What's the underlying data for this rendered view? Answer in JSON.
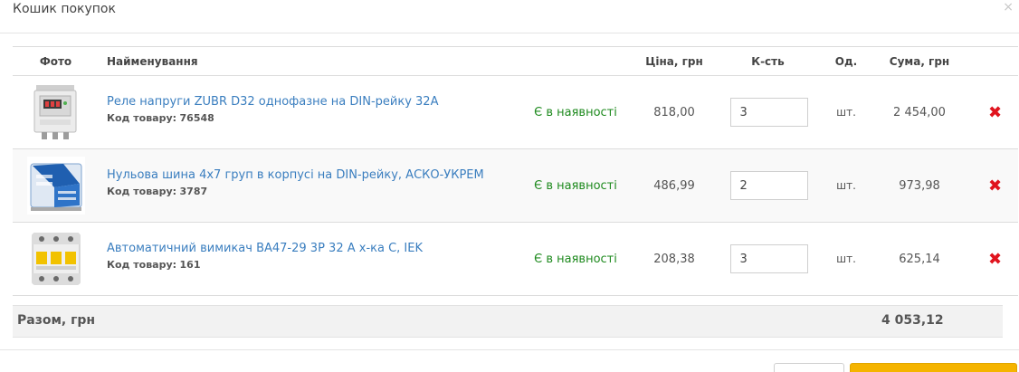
{
  "modal": {
    "title": "Кошик покупок",
    "close_glyph": "×"
  },
  "table": {
    "headers": {
      "photo": "Фото",
      "name": "Найменування",
      "price": "Ціна, грн",
      "qty": "К-сть",
      "unit": "Од.",
      "sum": "Сума, грн"
    },
    "rows": [
      {
        "image_icon": "voltage-relay-image",
        "name": "Реле напруги ZUBR D32 однофазне на DIN-рейку 32А",
        "code_label": "Код товару:",
        "code": "76548",
        "stock": "Є в наявності",
        "price": "818,00",
        "qty": "3",
        "unit": "шт.",
        "sum": "2 454,00",
        "delete_icon": "red-x-icon"
      },
      {
        "image_icon": "neutral-busbar-image",
        "name": "Нульова шина 4х7 груп в корпусі на DIN-рейку, АСКО-УКРЕМ",
        "code_label": "Код товару:",
        "code": "3787",
        "stock": "Є в наявності",
        "price": "486,99",
        "qty": "2",
        "unit": "шт.",
        "sum": "973,98",
        "delete_icon": "red-x-icon"
      },
      {
        "image_icon": "circuit-breaker-image",
        "name": "Автоматичний вимикач ВА47-29 3Р 32 А х-ка С, IEK",
        "code_label": "Код товару:",
        "code": "161",
        "stock": "Є в наявності",
        "price": "208,38",
        "qty": "3",
        "unit": "шт.",
        "sum": "625,14",
        "delete_icon": "red-x-icon"
      }
    ]
  },
  "total": {
    "label": "Разом, грн",
    "value": "4 053,12"
  },
  "colors": {
    "link": "#3a7ebf",
    "stock": "#1e8a1e",
    "delete": "#e0141e",
    "primary_button": "#f5b400"
  }
}
